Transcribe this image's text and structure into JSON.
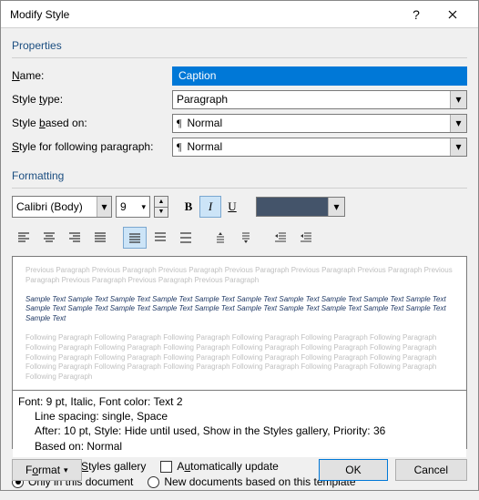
{
  "title": "Modify Style",
  "sections": {
    "properties": "Properties",
    "formatting": "Formatting"
  },
  "properties": {
    "name_label": "Name:",
    "name_value": "Caption",
    "styletype_label": "Style type:",
    "styletype_value": "Paragraph",
    "basedon_label": "Style based on:",
    "basedon_value": "Normal",
    "following_label": "Style for following paragraph:",
    "following_value": "Normal"
  },
  "formatting": {
    "font_name": "Calibri (Body)",
    "font_size": "9",
    "bold_label": "B",
    "italic_label": "I",
    "underline_label": "U",
    "color": "#44546a"
  },
  "preview": {
    "prev_text": "Previous Paragraph Previous Paragraph Previous Paragraph Previous Paragraph Previous Paragraph Previous Paragraph Previous Paragraph Previous Paragraph Previous Paragraph Previous Paragraph",
    "sample_text": "Sample Text Sample Text Sample Text Sample Text Sample Text Sample Text Sample Text Sample Text Sample Text Sample Text Sample Text Sample Text Sample Text Sample Text Sample Text Sample Text Sample Text Sample Text Sample Text Sample Text Sample Text",
    "follow_text": "Following Paragraph Following Paragraph Following Paragraph Following Paragraph Following Paragraph Following Paragraph Following Paragraph Following Paragraph Following Paragraph Following Paragraph Following Paragraph Following Paragraph Following Paragraph Following Paragraph Following Paragraph Following Paragraph Following Paragraph Following Paragraph Following Paragraph Following Paragraph Following Paragraph Following Paragraph Following Paragraph Following Paragraph Following Paragraph"
  },
  "description": {
    "line1": "Font: 9 pt, Italic, Font color: Text 2",
    "line2": "Line spacing:  single, Space",
    "line3": "After:  10 pt, Style: Hide until used, Show in the Styles gallery, Priority: 36",
    "line4": "Based on: Normal"
  },
  "options": {
    "add_gallery": "Add to the Styles gallery",
    "auto_update": "Automatically update",
    "only_doc": "Only in this document",
    "new_template": "New documents based on this template"
  },
  "buttons": {
    "format": "Format",
    "ok": "OK",
    "cancel": "Cancel"
  }
}
